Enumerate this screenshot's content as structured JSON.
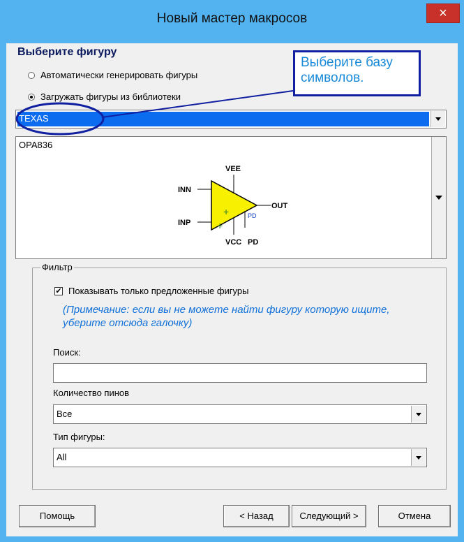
{
  "window": {
    "title": "Новый мастер макросов",
    "close_label": "×"
  },
  "shape_section": {
    "heading": "Выберите фигуру",
    "radio_auto": "Автоматически генерировать фигуры",
    "radio_library": "Загружать фигуры из библиотеки",
    "selected_radio": "library"
  },
  "callout": {
    "text": "Выберите базу символов."
  },
  "library": {
    "selected": "TEXAS"
  },
  "preview": {
    "part_name": "OPA836",
    "pins": {
      "top": "VEE",
      "left_top": "INN",
      "left_bottom": "INP",
      "right": "OUT",
      "bottom": "VCC",
      "bottom_right_label": "PD",
      "bottom_right": "PD"
    }
  },
  "filter": {
    "legend": "Фильтр",
    "show_suggested_label": "Показывать только предложенные фигуры",
    "show_suggested_checked": true,
    "note": "(Примечание: если вы не можете найти фигуру которую ищите, уберите отсюда галочку)",
    "search_label": "Поиск:",
    "search_value": "",
    "pin_count_label": "Количество пинов",
    "pin_count_value": "Все",
    "shape_type_label": "Тип фигуры:",
    "shape_type_value": "All"
  },
  "buttons": {
    "help": "Помощь",
    "back": "< Назад",
    "next": "Следующий >",
    "cancel": "Отмена"
  },
  "colors": {
    "titlebar": "#53b3f0",
    "close": "#c7312a",
    "selection": "#0b6cf0",
    "callout_border": "#1020a0",
    "note": "#1070d8"
  }
}
